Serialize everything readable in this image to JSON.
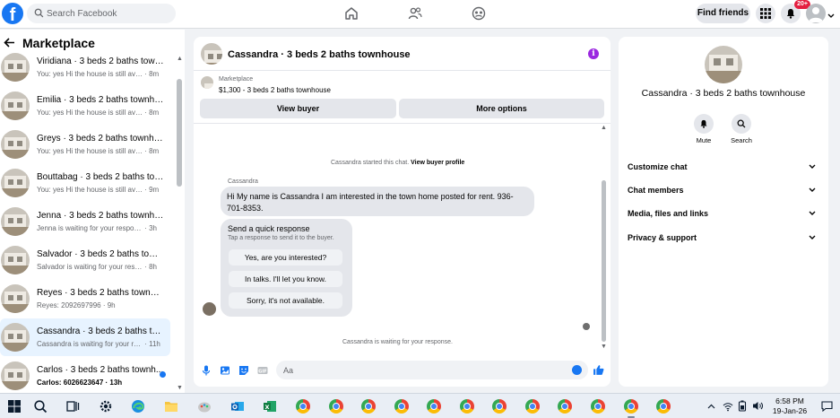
{
  "topbar": {
    "search_placeholder": "Search Facebook",
    "find_friends": "Find friends",
    "notification_count": "20+"
  },
  "sidebar": {
    "title": "Marketplace",
    "chats": [
      {
        "name": "Viridiana · 3 beds 2 baths town...",
        "preview": "You: yes Hi the house is still availa...",
        "time": "8m"
      },
      {
        "name": "Emilia · 3 beds 2 baths townhou...",
        "preview": "You: yes Hi the house is still availa...",
        "time": "8m"
      },
      {
        "name": "Greys · 3 beds 2 baths townhouse",
        "preview": "You: yes Hi the house is still availa...",
        "time": "8m"
      },
      {
        "name": "Bouttabag · 3 beds 2 baths tow...",
        "preview": "You: yes Hi the house is still availa...",
        "time": "9m"
      },
      {
        "name": "Jenna · 3 beds 2 baths townhou...",
        "preview": "Jenna is waiting for your response.",
        "time": "3h"
      },
      {
        "name": "Salvador · 3 beds 2 baths townh...",
        "preview": "Salvador is waiting for your respo...",
        "time": "8h"
      },
      {
        "name": "Reyes · 3 beds 2 baths townhou...",
        "preview": "Reyes: 2092697996",
        "time": "9h"
      },
      {
        "name": "Cassandra · 3 beds 2 baths tow...",
        "preview": "Cassandra is waiting for your res...",
        "time": "11h"
      },
      {
        "name": "Carlos · 3 beds 2 baths townh...",
        "preview": "Carlos: 6026623647",
        "time": "13h"
      }
    ]
  },
  "chat": {
    "title": "Cassandra · 3 beds 2 baths townhouse",
    "listing_source": "Marketplace",
    "listing_text": "$1,300 - 3 beds 2 baths townhouse",
    "view_buyer": "View buyer",
    "more_options": "More options",
    "started_text": "Cassandra started this chat.",
    "view_buyer_profile": "View buyer profile",
    "sender_name": "Cassandra",
    "message": "Hi My name is Cassandra I am interested in the town home posted for rent. 936-701-8353.",
    "quick_title": "Send a quick response",
    "quick_sub": "Tap a response to send it to the buyer.",
    "quick_responses": [
      "Yes, are you interested?",
      "In talks. I'll let you know.",
      "Sorry, it's not available."
    ],
    "waiting_text": "Cassandra is waiting for your response.",
    "composer_placeholder": "Aa"
  },
  "details": {
    "name": "Cassandra · 3 beds 2 baths townhouse",
    "mute": "Mute",
    "search": "Search",
    "sections": [
      "Customize chat",
      "Chat members",
      "Media, files and links",
      "Privacy & support"
    ]
  },
  "taskbar": {
    "time": "6:58 PM",
    "date": "19-Jan-26"
  },
  "colors": {
    "brand": "#1877f2",
    "info": "#9b27e0",
    "badge": "#e41e3f",
    "active_chat": "#e7f3ff"
  }
}
